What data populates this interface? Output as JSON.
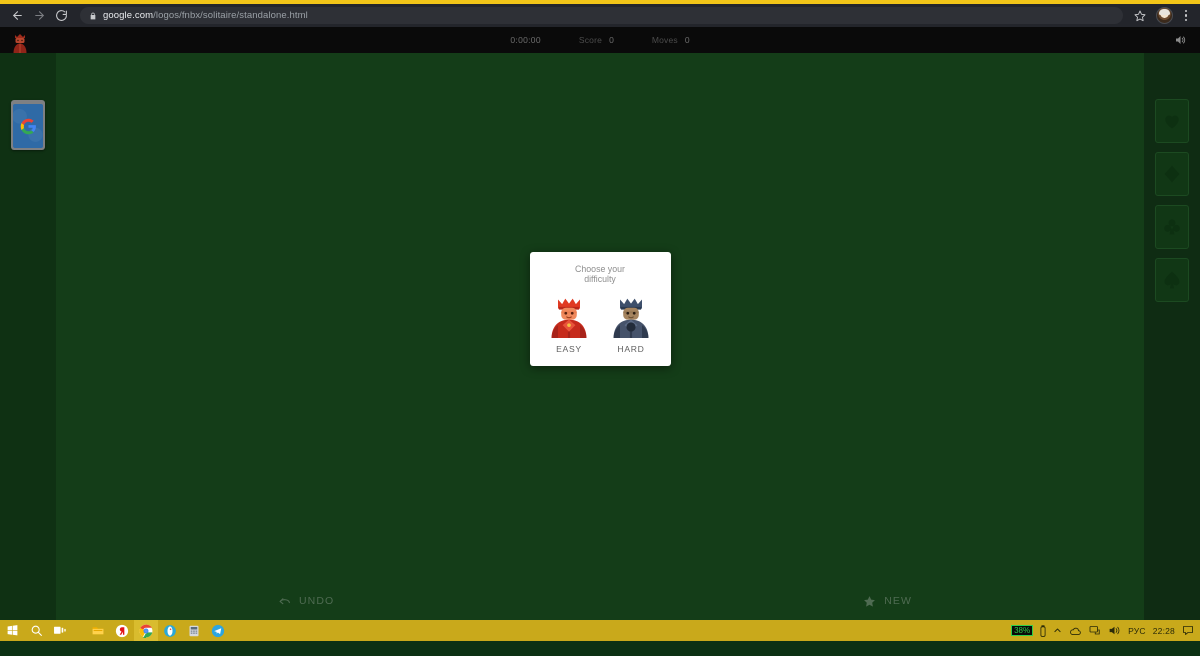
{
  "browser": {
    "back_label": "Back",
    "forward_label": "Forward",
    "reload_label": "Reload",
    "lock_label": "secure-connection",
    "url_host": "google.com",
    "url_path": "/logos/fnbx/solitaire/standalone.html",
    "bookmark_label": "Bookmark this page",
    "profile_label": "Profile",
    "menu_label": "Customize and control Google Chrome"
  },
  "game": {
    "logo_label": "Solitaire character logo",
    "timer": "0:00:00",
    "score_label": "Score",
    "score_value": "0",
    "moves_label": "Moves",
    "moves_value": "0",
    "sound_label": "Sound on",
    "stock_label": "Stock pile",
    "stock_logo": "google-g-logo",
    "foundations": [
      {
        "name": "hearts",
        "symbol": "♥"
      },
      {
        "name": "diamonds",
        "symbol": "♦"
      },
      {
        "name": "clubs",
        "symbol": "♣"
      },
      {
        "name": "spades",
        "symbol": "♠"
      }
    ],
    "undo_label": "UNDO",
    "new_label": "NEW",
    "felt_color": "#143d18",
    "rail_color": "#0f3113"
  },
  "modal": {
    "title_line1": "Choose your",
    "title_line2": "difficulty",
    "easy_label": "EASY",
    "hard_label": "HARD",
    "easy_color": "#d32f1f",
    "hard_color": "#3b4a63"
  },
  "taskbar": {
    "start_label": "Start",
    "search_label": "Search",
    "taskview_label": "Task View",
    "apps": [
      {
        "name": "file-explorer",
        "label": "File Explorer"
      },
      {
        "name": "yandex-browser",
        "label": "Yandex Browser"
      },
      {
        "name": "google-chrome",
        "label": "Google Chrome"
      },
      {
        "name": "opera-browser",
        "label": "Opera"
      },
      {
        "name": "calculator",
        "label": "Calculator"
      },
      {
        "name": "telegram",
        "label": "Telegram"
      }
    ],
    "battery_percent": "38%",
    "language": "РУС",
    "clock": "22:28",
    "notification_label": "Notifications"
  }
}
